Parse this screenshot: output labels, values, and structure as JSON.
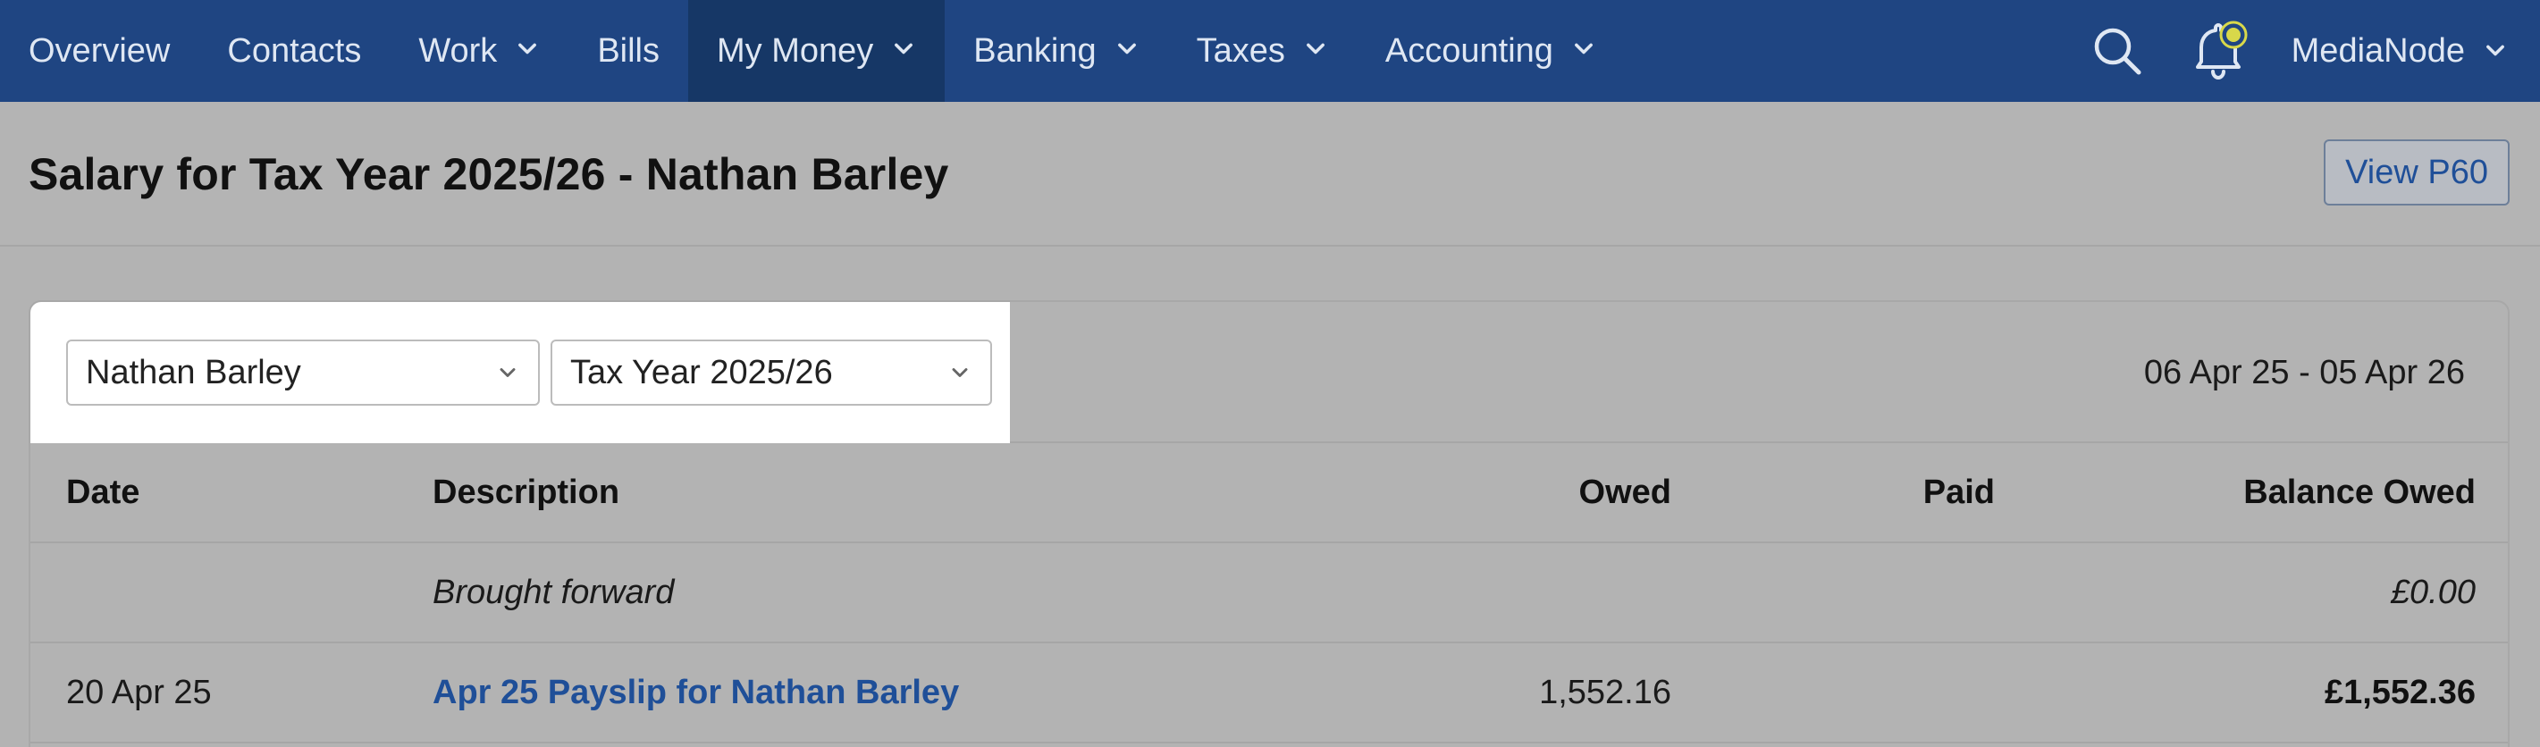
{
  "nav": {
    "items": [
      {
        "label": "Overview",
        "dropdown": false,
        "active": false
      },
      {
        "label": "Contacts",
        "dropdown": false,
        "active": false
      },
      {
        "label": "Work",
        "dropdown": true,
        "active": false
      },
      {
        "label": "Bills",
        "dropdown": false,
        "active": false
      },
      {
        "label": "My Money",
        "dropdown": true,
        "active": true
      },
      {
        "label": "Banking",
        "dropdown": true,
        "active": false
      },
      {
        "label": "Taxes",
        "dropdown": true,
        "active": false
      },
      {
        "label": "Accounting",
        "dropdown": true,
        "active": false
      }
    ],
    "org_name": "MediaNode"
  },
  "page": {
    "title": "Salary for Tax Year 2025/26 - Nathan Barley",
    "view_p60_label": "View P60"
  },
  "filters": {
    "employee_selected": "Nathan Barley",
    "tax_year_selected": "Tax Year 2025/26",
    "date_range": "06 Apr 25 - 05 Apr 26"
  },
  "table": {
    "headers": {
      "date": "Date",
      "description": "Description",
      "owed": "Owed",
      "paid": "Paid",
      "balance": "Balance Owed"
    },
    "rows": [
      {
        "date": "",
        "description": "Brought forward",
        "owed": "",
        "paid": "",
        "balance": "£0.00"
      },
      {
        "date": "20 Apr 25",
        "description": "Apr 25 Payslip for Nathan Barley",
        "owed": "1,552.16",
        "paid": "",
        "balance": "£1,552.36"
      }
    ]
  },
  "colors": {
    "nav_bg": "#1f4582",
    "nav_active_bg": "#163766",
    "link": "#1f4f98",
    "notification_dot": "#d8d84a"
  }
}
